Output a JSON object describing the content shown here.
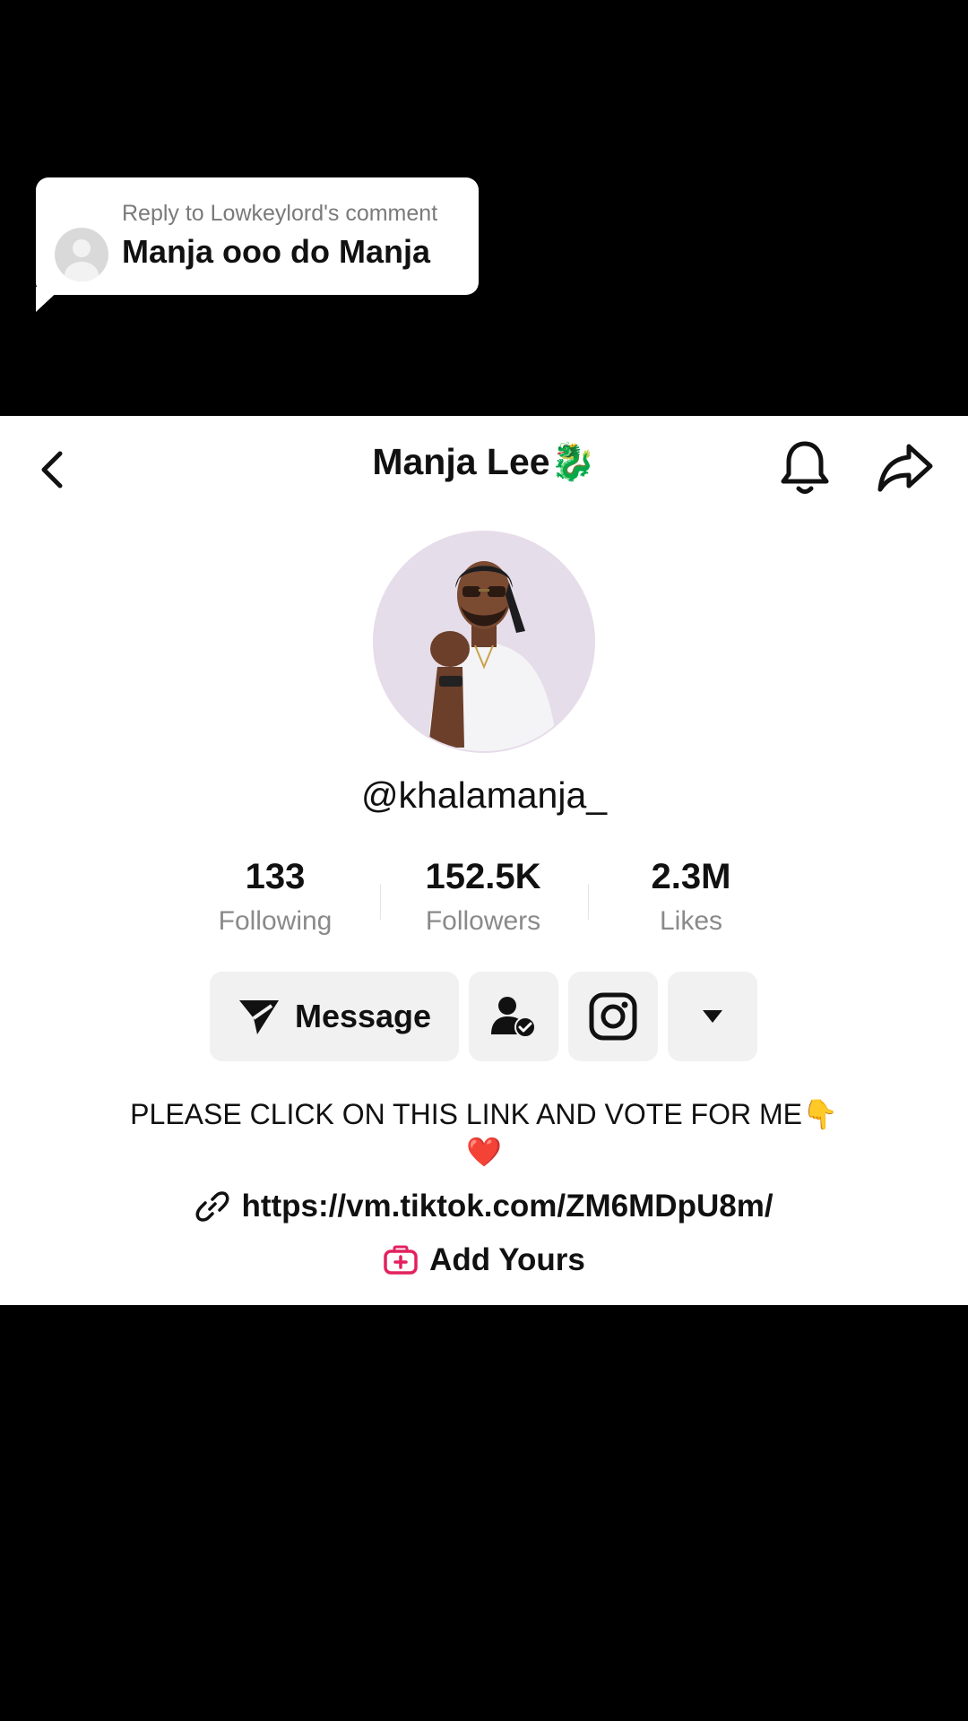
{
  "reply": {
    "subtitle": "Reply to Lowkeylord's comment",
    "comment": "Manja ooo do Manja"
  },
  "profile": {
    "title": "Manja Lee🐉",
    "handle": "@khalamanja_",
    "stats": [
      {
        "value": "133",
        "label": "Following"
      },
      {
        "value": "152.5K",
        "label": "Followers"
      },
      {
        "value": "2.3M",
        "label": "Likes"
      }
    ],
    "buttons": {
      "message": "Message"
    },
    "bio_line1": "PLEASE CLICK ON THIS LINK AND VOTE FOR ME👇",
    "bio_line2": "❤️",
    "link": "https://vm.tiktok.com/ZM6MDpU8m/",
    "add_yours": "Add Yours"
  },
  "icons": {
    "back": "chevron-left-icon",
    "bell": "bell-icon",
    "share": "share-icon",
    "send": "send-icon",
    "friends": "user-check-icon",
    "instagram": "instagram-icon",
    "more": "caret-down-icon",
    "link": "link-icon",
    "add_yours": "add-yours-icon"
  },
  "colors": {
    "accent": "#e3215f",
    "background": "#000000",
    "panel": "#ffffff",
    "button_bg": "#f1f1f2"
  }
}
